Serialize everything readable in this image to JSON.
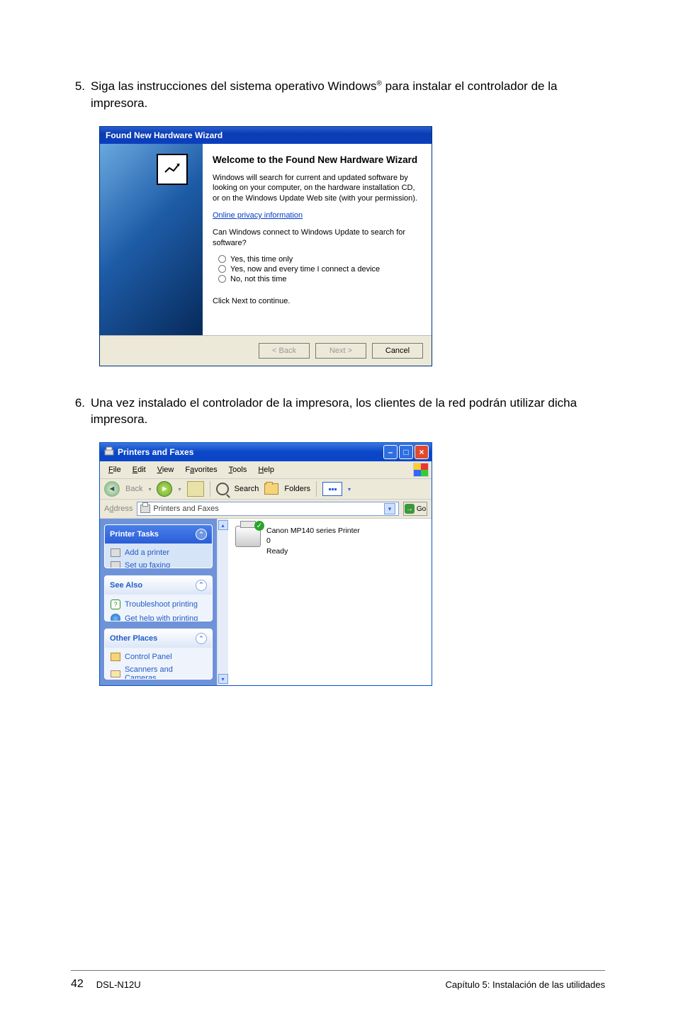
{
  "step5": {
    "number": "5.",
    "text_a": "Siga las instrucciones del sistema operativo Windows",
    "sup": "®",
    "text_b": " para instalar el controlador de la impresora."
  },
  "wizard": {
    "titlebar": "Found New Hardware Wizard",
    "heading": "Welcome to the Found New Hardware Wizard",
    "para1": "Windows will search for current and updated software by looking on your computer, on the hardware installation CD, or on the Windows Update Web site (with your permission).",
    "privacy_link": "Online privacy information",
    "para2": "Can Windows connect to Windows Update to search for software?",
    "radio1": "Yes, this time only",
    "radio2": "Yes, now and every time I connect a device",
    "radio3": "No, not this time",
    "continue": "Click Next to continue.",
    "btn_back": "< Back",
    "btn_next": "Next >",
    "btn_cancel": "Cancel"
  },
  "step6": {
    "number": "6.",
    "text": "Una vez instalado el controlador de la impresora, los clientes de la red podrán utilizar dicha impresora."
  },
  "explorer": {
    "title": "Printers and Faxes",
    "menus": {
      "file": "File",
      "edit": "Edit",
      "view": "View",
      "favorites": "Favorites",
      "tools": "Tools",
      "help": "Help"
    },
    "toolbar": {
      "back": "Back",
      "search": "Search",
      "folders": "Folders"
    },
    "address_label": "Address",
    "address_value": "Printers and Faxes",
    "go": "Go",
    "panels": {
      "printer_tasks": {
        "title": "Printer Tasks",
        "add_printer": "Add a printer",
        "set_up_faxing": "Set up faxing"
      },
      "see_also": {
        "title": "See Also",
        "troubleshoot": "Troubleshoot printing",
        "get_help": "Get help with printing"
      },
      "other_places": {
        "title": "Other Places",
        "control_panel": "Control Panel",
        "scanners": "Scanners and Cameras"
      }
    },
    "printer": {
      "name": "Canon MP140 series Printer",
      "docs": "0",
      "status": "Ready"
    }
  },
  "footer": {
    "page": "42",
    "model": "DSL-N12U",
    "chapter": "Capítulo 5: Instalación de las utilidades"
  }
}
